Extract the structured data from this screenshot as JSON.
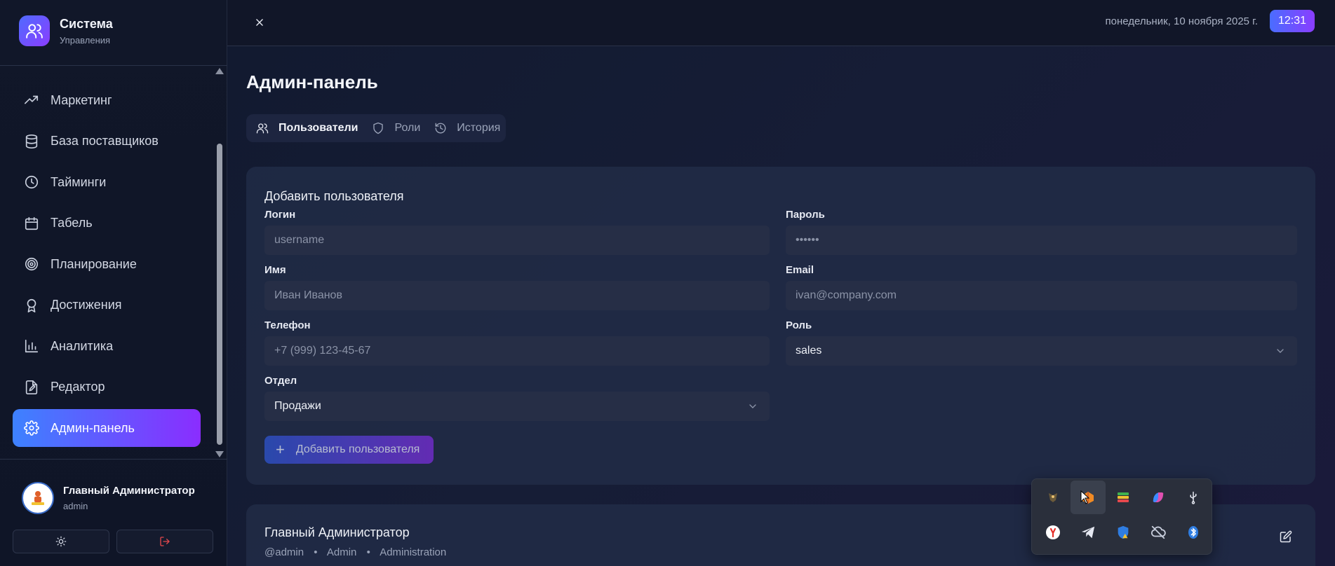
{
  "brand": {
    "title": "Система",
    "subtitle": "Управления"
  },
  "sidebar": {
    "items": [
      {
        "label": "Маркетинг",
        "icon": "trending-up-icon"
      },
      {
        "label": "База поставщиков",
        "icon": "database-icon"
      },
      {
        "label": "Тайминги",
        "icon": "clock-icon"
      },
      {
        "label": "Табель",
        "icon": "calendar-icon"
      },
      {
        "label": "Планирование",
        "icon": "target-icon"
      },
      {
        "label": "Достижения",
        "icon": "award-icon"
      },
      {
        "label": "Аналитика",
        "icon": "bar-chart-icon"
      },
      {
        "label": "Редактор",
        "icon": "file-edit-icon"
      },
      {
        "label": "Админ-панель",
        "icon": "gear-icon",
        "active": true
      }
    ],
    "user": {
      "name": "Главный Администратор",
      "role": "admin"
    }
  },
  "header": {
    "date": "понедельник, 10 ноября 2025 г.",
    "time": "12:31"
  },
  "main": {
    "title": "Админ-панель",
    "tabs": [
      {
        "label": "Пользователи",
        "icon": "users-icon",
        "active": true
      },
      {
        "label": "Роли",
        "icon": "shield-icon"
      },
      {
        "label": "История",
        "icon": "history-icon"
      }
    ],
    "form": {
      "title": "Добавить пользователя",
      "login": {
        "label": "Логин",
        "placeholder": "username"
      },
      "password": {
        "label": "Пароль",
        "placeholder": "••••••"
      },
      "name": {
        "label": "Имя",
        "placeholder": "Иван Иванов"
      },
      "email": {
        "label": "Email",
        "placeholder": "ivan@company.com"
      },
      "phone": {
        "label": "Телефон",
        "placeholder": "+7 (999) 123-45-67"
      },
      "role": {
        "label": "Роль",
        "value": "sales"
      },
      "department": {
        "label": "Отдел",
        "value": "Продажи"
      },
      "submit_label": "Добавить пользователя"
    },
    "user_card": {
      "name": "Главный Администратор",
      "handle": "@admin",
      "role": "Admin",
      "department": "Administration",
      "separator": "•"
    }
  },
  "tray": {
    "icons": [
      "tray-app-icon",
      "firefox-icon",
      "bluestacks-icon",
      "copilot-icon",
      "usb-icon",
      "yandex-icon",
      "telegram-icon",
      "defender-icon",
      "cloud-off-icon",
      "bluetooth-icon"
    ]
  },
  "colors": {
    "accent_start": "#3d82ff",
    "accent_end": "#8a2dff",
    "background": "#0f1426",
    "card": "#212c46"
  }
}
